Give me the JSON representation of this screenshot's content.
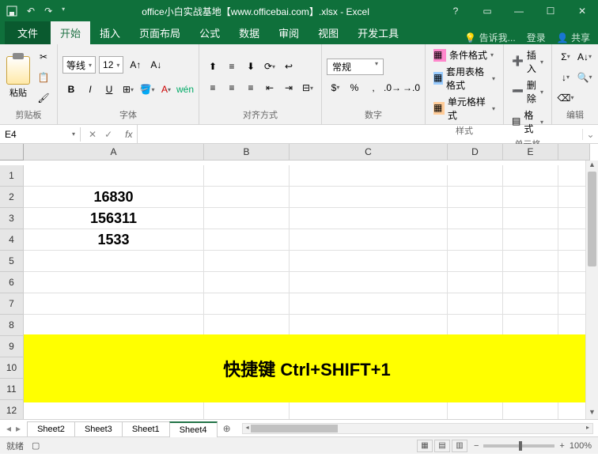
{
  "titlebar": {
    "title": "office小白实战基地【www.officebai.com】.xlsx - Excel"
  },
  "winbtns": {
    "help": "?",
    "min": "—",
    "max": "☐",
    "close": "✕"
  },
  "tabs": {
    "file": "文件",
    "home": "开始",
    "insert": "插入",
    "layout": "页面布局",
    "formulas": "公式",
    "data": "数据",
    "review": "审阅",
    "view": "视图",
    "dev": "开发工具",
    "tell": "告诉我...",
    "login": "登录",
    "share": "共享"
  },
  "ribbon": {
    "clipboard": {
      "label": "剪贴板",
      "paste": "粘贴"
    },
    "font": {
      "label": "字体",
      "name": "等线",
      "size": "12"
    },
    "align": {
      "label": "对齐方式"
    },
    "number": {
      "label": "数字",
      "format": "常规"
    },
    "styles": {
      "label": "样式",
      "cond": "条件格式",
      "table": "套用表格格式",
      "cell": "单元格样式"
    },
    "cells": {
      "label": "单元格",
      "insert": "插入",
      "delete": "删除",
      "format": "格式"
    },
    "editing": {
      "label": "编辑"
    }
  },
  "namebox": "E4",
  "formula": "",
  "cols": [
    "A",
    "B",
    "C",
    "D",
    "E"
  ],
  "rows": [
    "1",
    "2",
    "3",
    "4",
    "5",
    "6",
    "7",
    "8",
    "9",
    "10",
    "11",
    "12"
  ],
  "cells": {
    "A2": "16830",
    "A3": "156311",
    "A4": "1533"
  },
  "banner": "快捷键 Ctrl+SHIFT+1",
  "sheets": {
    "items": [
      "Sheet2",
      "Sheet3",
      "Sheet1",
      "Sheet4"
    ],
    "active": 3
  },
  "status": {
    "ready": "就绪",
    "zoom": "100%"
  }
}
